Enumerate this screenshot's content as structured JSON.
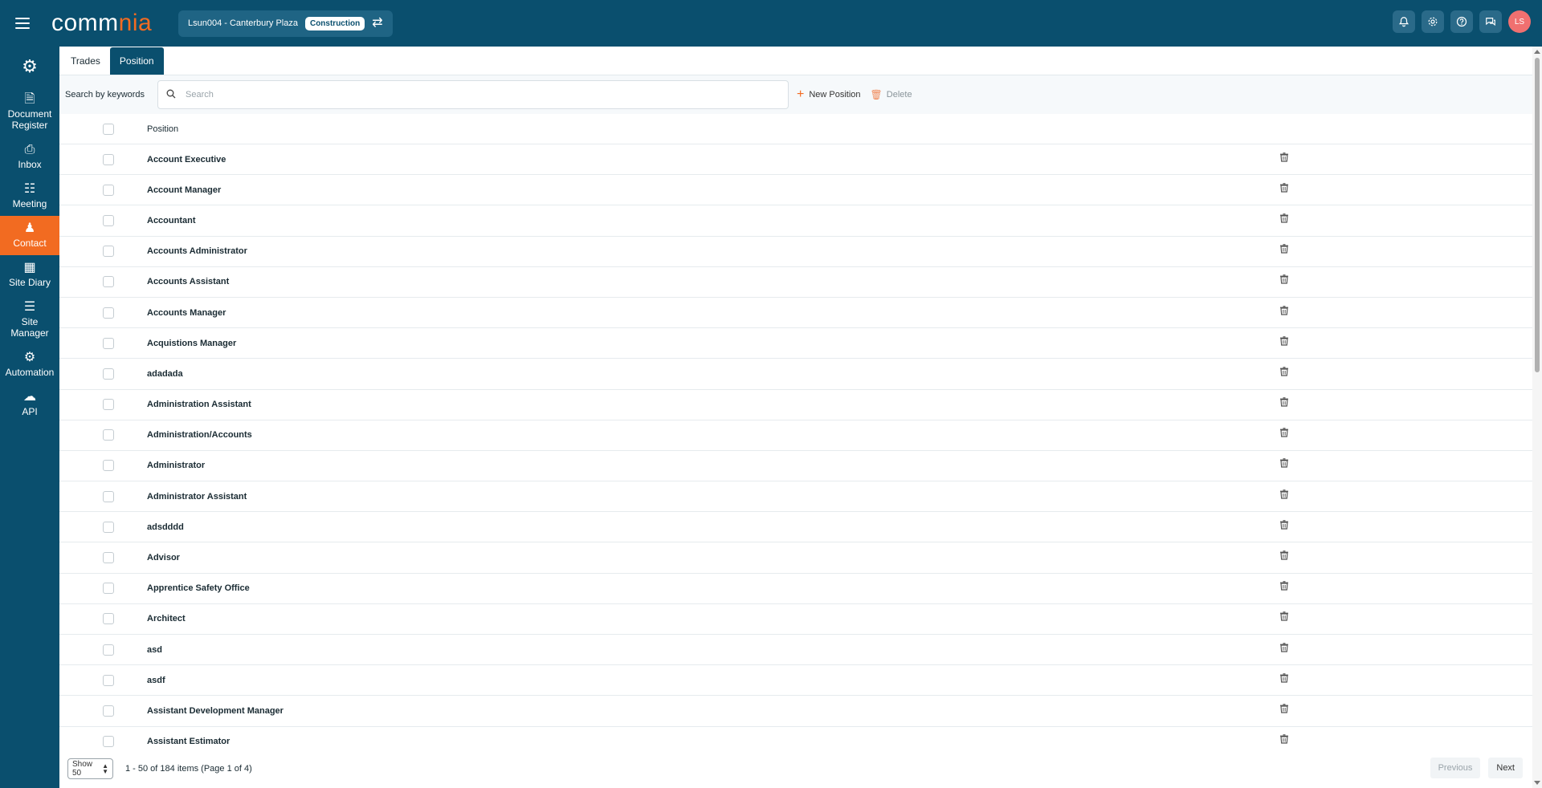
{
  "app": {
    "logo_prefix": "comm",
    "logo_accent": "nia",
    "brand_color": "#0a4f6e",
    "accent_color": "#f26b21"
  },
  "header": {
    "project_name": "Lsun004 - Canterbury Plaza",
    "project_badge": "Construction",
    "user_initials": "LS",
    "icons": [
      "bell-icon",
      "gear-icon",
      "help-icon",
      "chat-icon"
    ]
  },
  "sidebar": {
    "items": [
      {
        "label": "Document Register",
        "icon": "document-icon"
      },
      {
        "label": "Inbox",
        "icon": "inbox-icon"
      },
      {
        "label": "Meeting",
        "icon": "meeting-icon"
      },
      {
        "label": "Contact",
        "icon": "contact-icon",
        "active": true
      },
      {
        "label": "Site Diary",
        "icon": "calendar-icon"
      },
      {
        "label": "Site Manager",
        "icon": "clipboard-icon"
      },
      {
        "label": "Automation",
        "icon": "automation-icon"
      },
      {
        "label": "API",
        "icon": "cloud-icon"
      }
    ]
  },
  "tabs": [
    {
      "label": "Trades",
      "active": false
    },
    {
      "label": "Position",
      "active": true
    }
  ],
  "toolbar": {
    "search_label": "Search by keywords",
    "search_placeholder": "Search",
    "new_label": "New Position",
    "delete_label": "Delete"
  },
  "table": {
    "column_header": "Position",
    "rows": [
      "Account Executive",
      "Account Manager",
      "Accountant",
      "Accounts Administrator",
      "Accounts Assistant",
      "Accounts Manager",
      "Acquistions Manager",
      "adadada",
      "Administration Assistant",
      "Administration/Accounts",
      "Administrator",
      "Administrator Assistant",
      "adsdddd",
      "Advisor",
      "Apprentice Safety Office",
      "Architect",
      "asd",
      "asdf",
      "Assistant Development Manager",
      "Assistant Estimator"
    ]
  },
  "footer": {
    "show_label": "Show 50",
    "page_info": "1 - 50 of 184 items (Page 1 of 4)",
    "previous_label": "Previous",
    "next_label": "Next"
  }
}
